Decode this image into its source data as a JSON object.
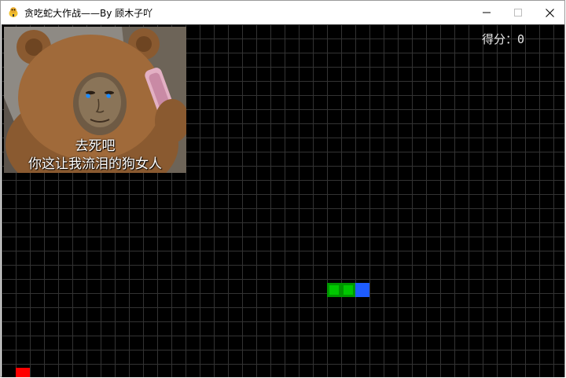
{
  "window": {
    "title": "贪吃蛇大作战——By 顾木子吖",
    "icon": "python-snake-icon",
    "controls": [
      "minimize-icon",
      "maximize-icon",
      "close-icon"
    ]
  },
  "game": {
    "score_label": "得分：",
    "score": "0",
    "grid": {
      "cols": 40,
      "rows": 25
    },
    "meme": {
      "line1": "去死吧",
      "line2": "你这让我流泪的狗女人"
    },
    "snake": {
      "head": {
        "col": 25,
        "row": 18
      },
      "body": [
        {
          "col": 24,
          "row": 18
        },
        {
          "col": 23,
          "row": 18
        }
      ]
    },
    "food": {
      "col": 1,
      "row": 24
    },
    "colors": {
      "background": "#000000",
      "grid_line": "#333333",
      "snake_body": "#00c800",
      "snake_body_border": "#009600",
      "snake_head": "#1e5cff",
      "food": "#ff0000",
      "score_text": "#e8e8e8"
    }
  }
}
